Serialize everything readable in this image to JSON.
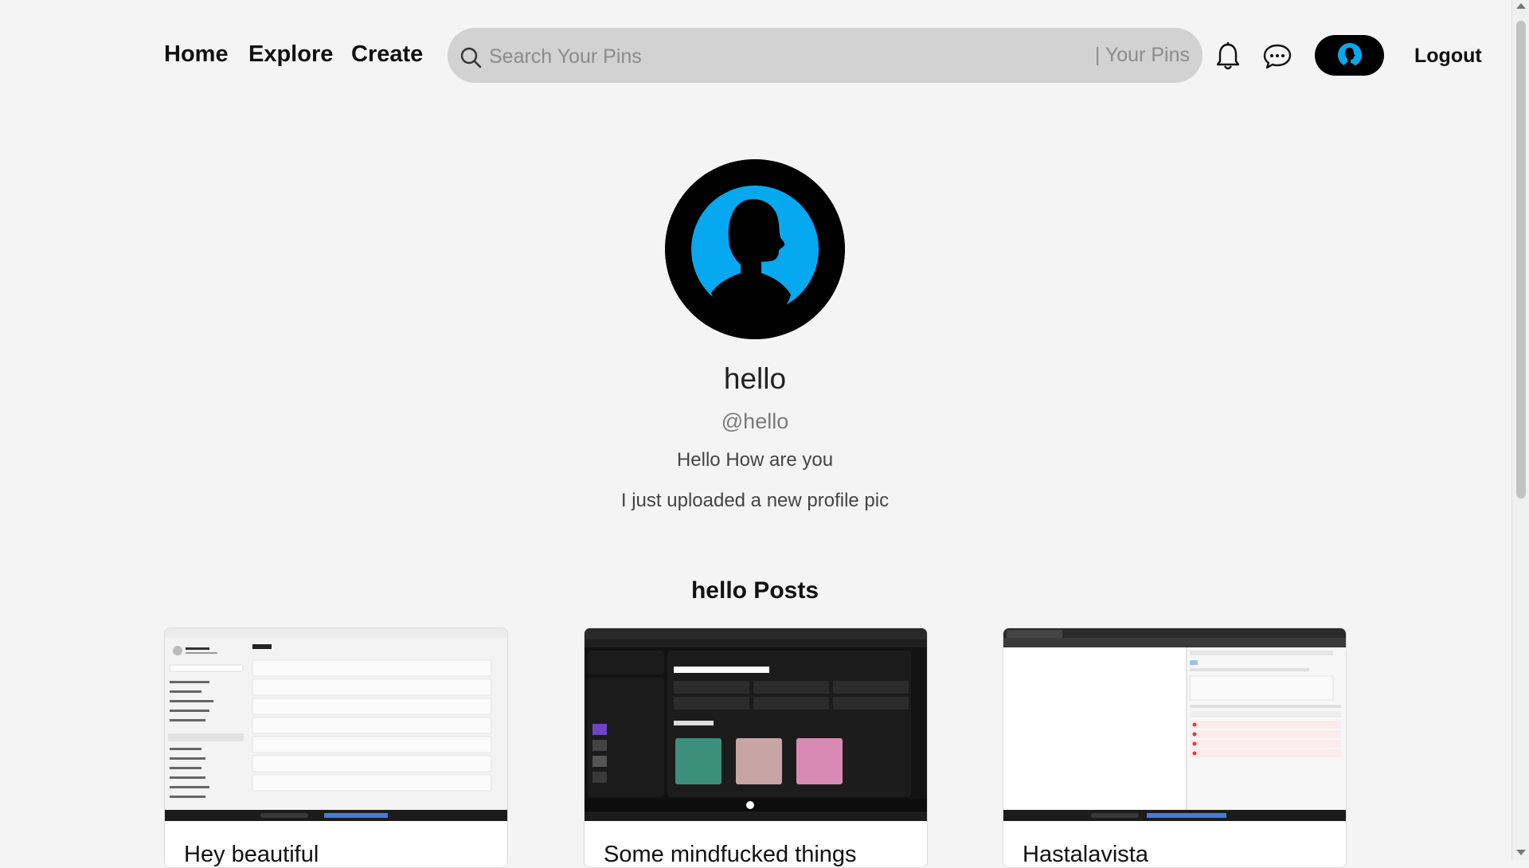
{
  "nav": {
    "home": "Home",
    "explore": "Explore",
    "create": "Create",
    "logout": "Logout"
  },
  "search": {
    "placeholder": "Search Your Pins",
    "scope_label": "| Your Pins"
  },
  "icons": {
    "search": "search-icon",
    "notifications": "bell-icon",
    "messages": "chat-icon",
    "avatar": "user-silhouette-icon"
  },
  "colors": {
    "background": "#f4f4f4",
    "search_bg": "#d2d2d2",
    "avatar_accent": "#06a8f0"
  },
  "profile": {
    "name": "hello",
    "handle": "@hello",
    "bio": "Hello How are you",
    "status": "I just uploaded a new profile pic"
  },
  "posts": {
    "heading": "hello Posts",
    "items": [
      {
        "title": "Hey beautiful"
      },
      {
        "title": "Some mindfucked things"
      },
      {
        "title": "Hastalavista"
      }
    ]
  }
}
